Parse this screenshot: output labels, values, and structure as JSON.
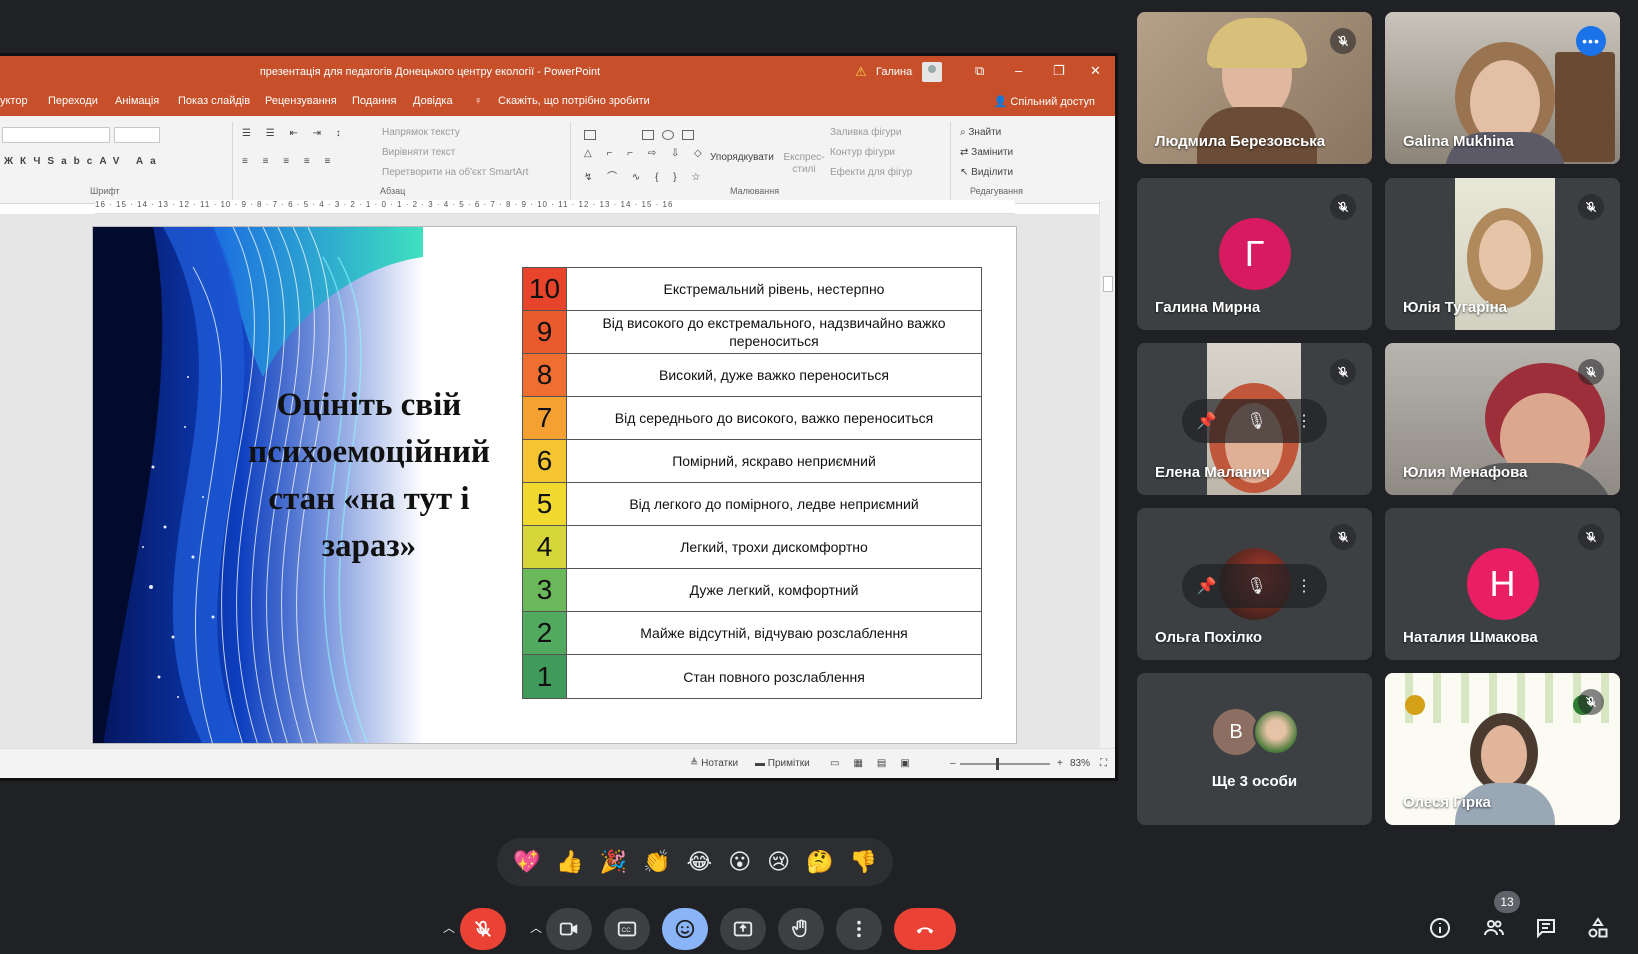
{
  "powerpoint": {
    "doc_title": "презентація для педагогів Донецького центру екології - PowerPoint",
    "user_name": "Галина",
    "window_buttons": [
      "⧉",
      "–",
      "❐",
      "✕"
    ],
    "menu": [
      "уктор",
      "Переходи",
      "Анімація",
      "Показ слайдів",
      "Рецензування",
      "Подання",
      "Довідка"
    ],
    "tell_me": "Скажіть, що потрібно зробити",
    "share": "Спільний доступ",
    "ribbon": {
      "font_group": "Шрифт",
      "paragraph_group": "Абзац",
      "drawing_group": "Малювання",
      "editing_group": "Редагування",
      "text_direction": "Напрямок тексту",
      "align_text": "Вирівняти текст",
      "convert_smartart": "Перетворити на об'єкт SmartArt",
      "arrange": "Упорядкувати",
      "quick_styles": "Експрес-стилі",
      "shape_fill": "Заливка фігури",
      "shape_outline": "Контур фігури",
      "shape_effects": "Ефекти для фігур",
      "find": "Знайти",
      "replace": "Замінити",
      "select": "Виділити"
    },
    "ruler": "16 · 15 · 14 · 13 · 12 · 11 · 10 · 9 · 8 · 7 · 6 · 5 · 4 · 3 · 2 · 1 · 0 · 1 · 2 · 3 · 4 · 5 · 6 · 7 · 8 · 9 · 10 · 11 · 12 · 13 · 14 · 15 · 16",
    "status": {
      "notes": "Нотатки",
      "comments": "Примітки",
      "zoom": "83%"
    }
  },
  "slide": {
    "heading": "Оцініть свій психоемоційний стан «на тут і зараз»",
    "scale": [
      {
        "num": "10",
        "text": "Екстремальний рівень, нестерпно",
        "color": "#e8442b"
      },
      {
        "num": "9",
        "text": "Від високого до екстремального, надзвичайно важко переноситься",
        "color": "#ea5a2d"
      },
      {
        "num": "8",
        "text": "Високий, дуже важко переноситься",
        "color": "#ef6e30"
      },
      {
        "num": "7",
        "text": "Від середнього до високого, важко переноситься",
        "color": "#f4a132"
      },
      {
        "num": "6",
        "text": "Помірний, яскраво неприємний",
        "color": "#f5c431"
      },
      {
        "num": "5",
        "text": "Від легкого до помірного, ледве неприємний",
        "color": "#f1d92f"
      },
      {
        "num": "4",
        "text": "Легкий, трохи дискомфортно",
        "color": "#d6d63a"
      },
      {
        "num": "3",
        "text": "Дуже легкий, комфортний",
        "color": "#6bb85b"
      },
      {
        "num": "2",
        "text": "Майже відсутній, відчуваю розслаблення",
        "color": "#52a960"
      },
      {
        "num": "1",
        "text": "Стан повного розслаблення",
        "color": "#3f9a5c"
      }
    ]
  },
  "participants": [
    {
      "name": "Людмила Березовська",
      "type": "video",
      "muted": true
    },
    {
      "name": "Galina Mukhina",
      "type": "video",
      "speaking": true
    },
    {
      "name": "Галина Мирна",
      "type": "avatar",
      "initial": "Г",
      "color": "#d81b60",
      "muted": true
    },
    {
      "name": "Юлія Тугаріна",
      "type": "video",
      "muted": true
    },
    {
      "name": "Елена Маланич",
      "type": "video",
      "muted": true
    },
    {
      "name": "Юлия Менафова",
      "type": "video",
      "muted": true
    },
    {
      "name": "Ольга Похілко",
      "type": "video",
      "muted": true
    },
    {
      "name": "Наталия Шмакова",
      "type": "avatar",
      "initial": "Н",
      "color": "#e91e63",
      "muted": true
    },
    {
      "name": "Ще 3 особи",
      "type": "more",
      "initial": "В",
      "color": "#8d6e63"
    },
    {
      "name": "Олеся Гірка",
      "type": "video",
      "muted": true
    }
  ],
  "reactions": [
    "💖",
    "👍",
    "🎉",
    "👏",
    "😂",
    "😮",
    "😢",
    "🤔",
    "👎"
  ],
  "participant_count": "13",
  "colors": {
    "ppt_accent": "#c7502a",
    "meet_bg": "#202124",
    "tile_bg": "#3c4043",
    "end_call": "#ea4335",
    "active_blue": "#8ab4f8"
  }
}
